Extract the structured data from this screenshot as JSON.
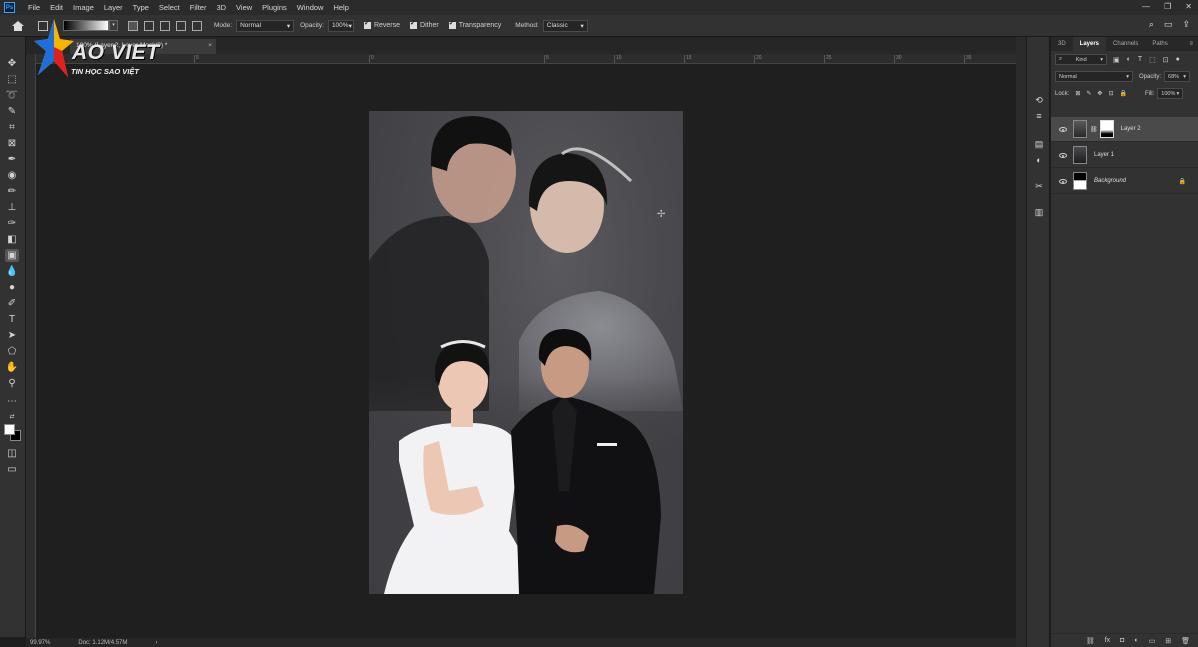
{
  "app": {
    "logo": "Ps"
  },
  "menu": [
    "File",
    "Edit",
    "Image",
    "Layer",
    "Type",
    "Select",
    "Filter",
    "3D",
    "View",
    "Plugins",
    "Window",
    "Help"
  ],
  "window_controls": [
    "—",
    "❐",
    "✕"
  ],
  "options": {
    "mode_label": "Mode:",
    "mode_value": "Normal",
    "opacity_label": "Opacity:",
    "opacity_value": "100%",
    "reverse_label": "Reverse",
    "dither_label": "Dither",
    "transparency_label": "Transparency",
    "method_label": "Method:",
    "method_value": "Classic"
  },
  "document_tab": {
    "title": "100% (Layer 2, Layer Mask/8) *"
  },
  "ruler_ticks": [
    "5",
    "0",
    "5",
    "10",
    "15",
    "20",
    "25",
    "30",
    "35"
  ],
  "status": {
    "zoom": "99.97%",
    "doc": "Doc: 1.12M/4.57M"
  },
  "layers_panel": {
    "tabs": [
      "3D",
      "Layers",
      "Channels",
      "Paths"
    ],
    "active_tab": "Layers",
    "kind_label": "Kind",
    "blend_mode": "Normal",
    "opacity_label": "Opacity:",
    "opacity_value": "68%",
    "lock_label": "Lock:",
    "fill_label": "Fill:",
    "fill_value": "100%",
    "layers": [
      {
        "name": "Layer 2",
        "selected": true
      },
      {
        "name": "Layer 1",
        "selected": false
      },
      {
        "name": "Background",
        "selected": false
      }
    ]
  },
  "watermark": {
    "brand": "AO VIET",
    "tagline": "TIN HỌC SAO VIỆT"
  }
}
